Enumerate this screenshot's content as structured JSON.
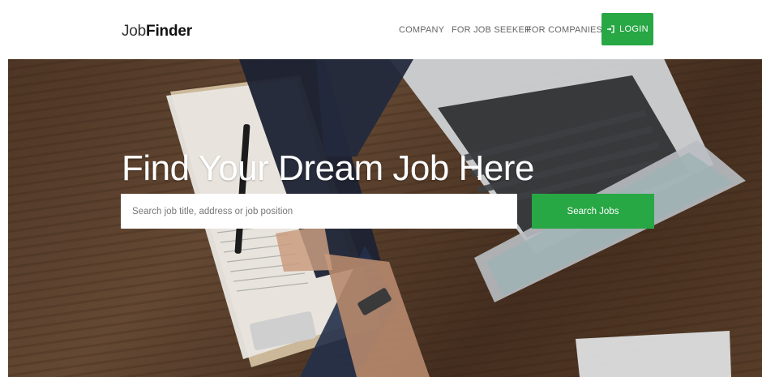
{
  "brand": {
    "light": "Job",
    "bold": "Finder"
  },
  "nav": {
    "links": [
      {
        "label": "COMPANY"
      },
      {
        "label": "FOR JOB SEEKER"
      },
      {
        "label": "FOR COMPANIES"
      }
    ],
    "login": {
      "label": "LOGIN",
      "icon": "sign-in-icon"
    }
  },
  "hero": {
    "title": "Find Your Dream Job Here",
    "search": {
      "placeholder": "Search job title, address or job position",
      "value": ""
    },
    "search_button": "Search Jobs"
  },
  "colors": {
    "accent": "#28a745",
    "nav_text": "#666666",
    "brand_text": "#111111"
  }
}
